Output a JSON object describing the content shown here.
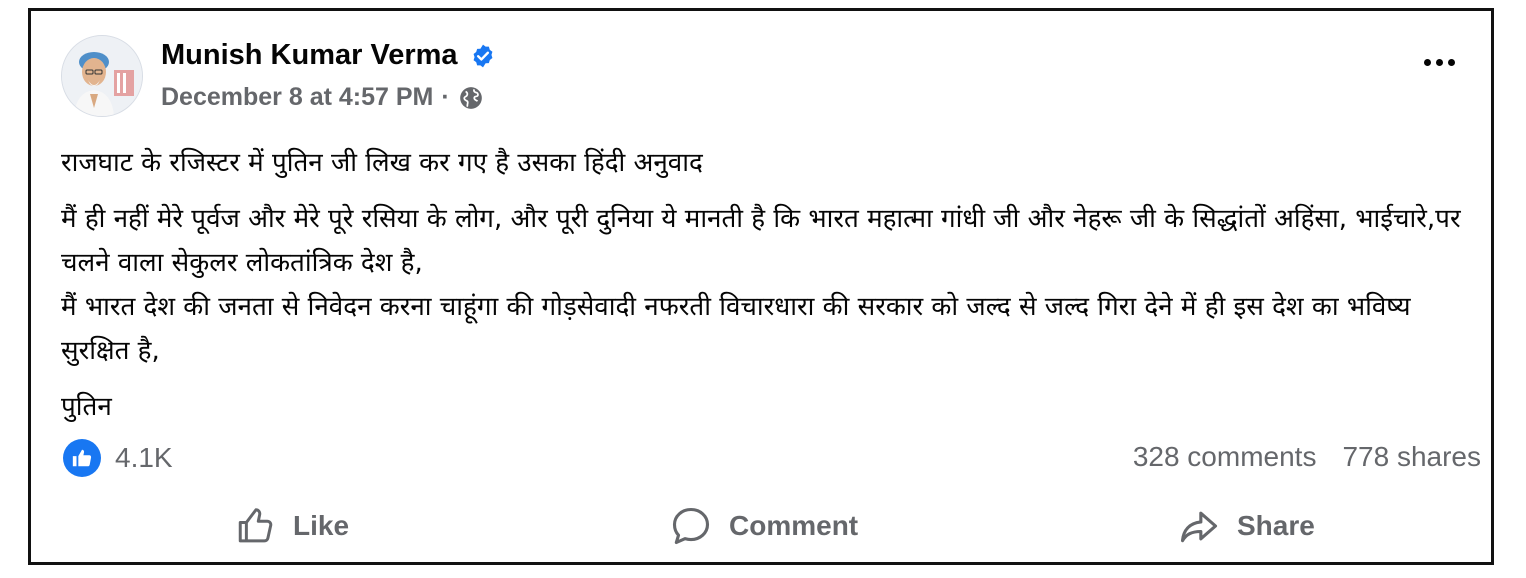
{
  "post": {
    "author": "Munish Kumar Verma",
    "timestamp": "December 8 at 4:57 PM",
    "separator": "·",
    "verified_icon": "verified-badge-icon",
    "privacy_icon": "globe-icon",
    "text": {
      "line1": "राजघाट के रजिस्टर में पुतिन जी लिख कर गए है उसका हिंदी अनुवाद",
      "para2a": "मैं ही नहीं मेरे पूर्वज और मेरे पूरे रसिया के लोग, और पूरी दुनिया ये मानती है कि भारत महात्मा गांधी जी और नेहरू जी के सिद्धांतों अहिंसा, भाईचारे,पर चलने वाला सेकुलर लोकतांत्रिक देश है,",
      "para2b": "मैं भारत देश की जनता से निवेदन करना चाहूंगा की गोड़सेवादी नफरती विचारधारा की सरकार को जल्द से जल्द गिरा देने में ही इस देश का भविष्य सुरक्षित है,",
      "signature": "पुतिन"
    },
    "reactions": {
      "count": "4.1K",
      "icon": "like-reaction-icon"
    },
    "comments": "328 comments",
    "shares": "778 shares"
  },
  "actions": {
    "like": "Like",
    "comment": "Comment",
    "share": "Share"
  },
  "colors": {
    "accent": "#1877f2",
    "muted_text": "#65676b",
    "text": "#050505",
    "border": "#111111"
  }
}
